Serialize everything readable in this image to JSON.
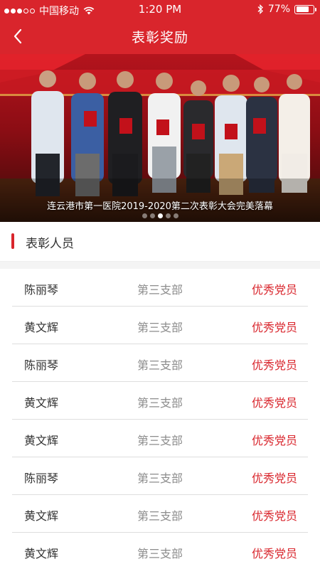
{
  "status_bar": {
    "carrier": "中国移动",
    "time": "1:20 PM",
    "battery": "77%",
    "battery_level": 0.77
  },
  "nav": {
    "title": "表彰奖励",
    "back_icon": "chevron-left-icon"
  },
  "banner": {
    "caption": "连云港市第一医院2019-2020第二次表彰大会完美落幕",
    "slide_count": 5,
    "active_slide": 3
  },
  "section": {
    "title": "表彰人员"
  },
  "honorees": [
    {
      "name": "陈丽琴",
      "branch": "第三支部",
      "award": "优秀党员"
    },
    {
      "name": "黄文辉",
      "branch": "第三支部",
      "award": "优秀党员"
    },
    {
      "name": "陈丽琴",
      "branch": "第三支部",
      "award": "优秀党员"
    },
    {
      "name": "黄文辉",
      "branch": "第三支部",
      "award": "优秀党员"
    },
    {
      "name": "黄文辉",
      "branch": "第三支部",
      "award": "优秀党员"
    },
    {
      "name": "陈丽琴",
      "branch": "第三支部",
      "award": "优秀党员"
    },
    {
      "name": "黄文辉",
      "branch": "第三支部",
      "award": "优秀党员"
    },
    {
      "name": "黄文辉",
      "branch": "第三支部",
      "award": "优秀党员"
    }
  ],
  "colors": {
    "primary": "#d9252c",
    "text": "#333333",
    "muted": "#8c8c8c"
  }
}
